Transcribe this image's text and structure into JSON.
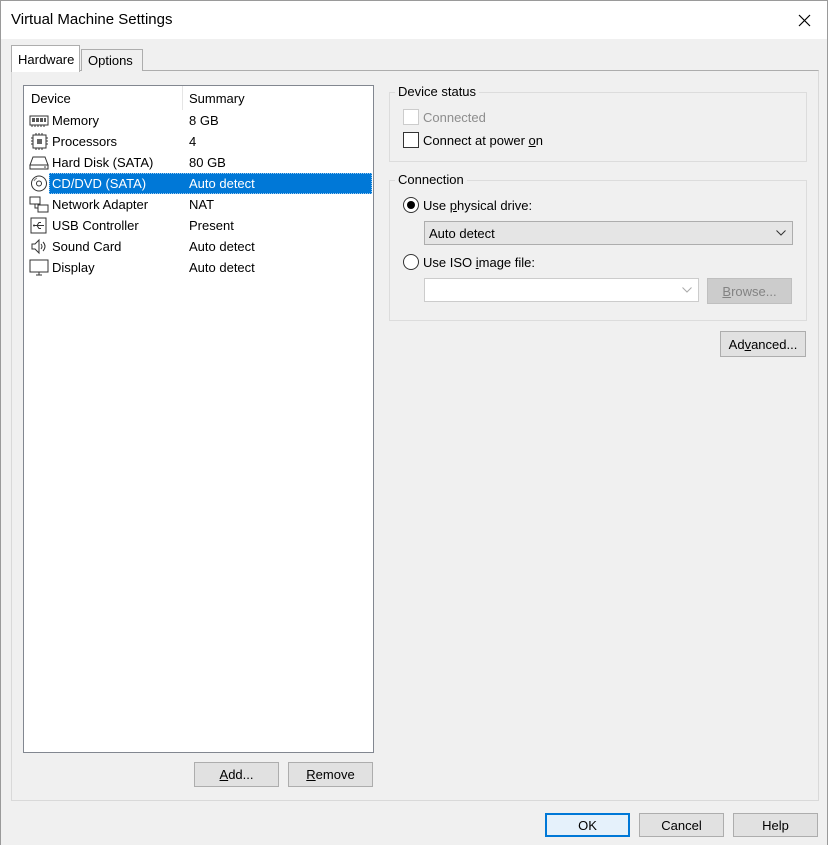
{
  "window": {
    "title": "Virtual Machine Settings"
  },
  "tabs": [
    {
      "label": "Hardware",
      "active": true
    },
    {
      "label": "Options",
      "active": false
    }
  ],
  "device_list": {
    "columns": {
      "device": "Device",
      "summary": "Summary"
    },
    "rows": [
      {
        "icon": "memory-icon",
        "device": "Memory",
        "summary": "8 GB",
        "selected": false
      },
      {
        "icon": "processor-icon",
        "device": "Processors",
        "summary": "4",
        "selected": false
      },
      {
        "icon": "hard-disk-icon",
        "device": "Hard Disk (SATA)",
        "summary": "80 GB",
        "selected": false
      },
      {
        "icon": "cd-dvd-icon",
        "device": "CD/DVD (SATA)",
        "summary": "Auto detect",
        "selected": true
      },
      {
        "icon": "network-adapter-icon",
        "device": "Network Adapter",
        "summary": "NAT",
        "selected": false
      },
      {
        "icon": "usb-icon",
        "device": "USB Controller",
        "summary": "Present",
        "selected": false
      },
      {
        "icon": "speaker-icon",
        "device": "Sound Card",
        "summary": "Auto detect",
        "selected": false
      },
      {
        "icon": "display-icon",
        "device": "Display",
        "summary": "Auto detect",
        "selected": false
      }
    ]
  },
  "list_buttons": {
    "add": "Add...",
    "remove": "Remove"
  },
  "device_status": {
    "legend": "Device status",
    "connected": {
      "label": "Connected",
      "checked": false,
      "enabled": false
    },
    "connect_at_power_on": {
      "label_pre": "Connect at power ",
      "label_u": "o",
      "label_post": "n",
      "checked": false
    }
  },
  "connection": {
    "legend": "Connection",
    "physical": {
      "label_pre": "Use ",
      "label_u": "p",
      "label_post": "hysical drive:",
      "selected": true
    },
    "physical_drive_value": "Auto detect",
    "iso": {
      "label_pre": "Use ISO ",
      "label_u": "i",
      "label_post": "mage file:",
      "selected": false
    },
    "iso_value": "",
    "browse": {
      "label_u": "B",
      "label_post": "rowse..."
    }
  },
  "advanced": {
    "label_pre": "Ad",
    "label_u": "v",
    "label_post": "anced..."
  },
  "dialog_buttons": {
    "ok": "OK",
    "cancel": "Cancel",
    "help": "Help"
  }
}
